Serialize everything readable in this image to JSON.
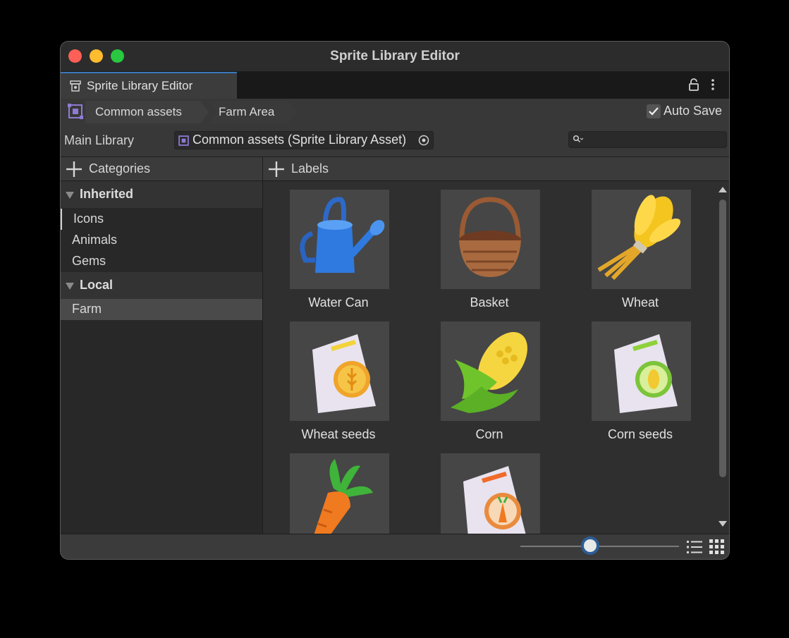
{
  "window": {
    "title": "Sprite Library Editor"
  },
  "tab": {
    "label": "Sprite Library Editor",
    "icon": "sprite-library-icon"
  },
  "breadcrumb": {
    "items": [
      "Common assets",
      "Farm Area"
    ]
  },
  "auto_save": {
    "label": "Auto Save",
    "checked": true
  },
  "main_library": {
    "label": "Main Library",
    "value": "Common assets (Sprite Library Asset)"
  },
  "search": {
    "placeholder": ""
  },
  "categories": {
    "header": "Categories",
    "groups": [
      {
        "name": "Inherited",
        "items": [
          "Icons",
          "Animals",
          "Gems"
        ]
      },
      {
        "name": "Local",
        "items": [
          "Farm"
        ]
      }
    ],
    "selected": "Farm"
  },
  "labels": {
    "header": "Labels",
    "items": [
      {
        "name": "Water Can",
        "icon": "watering-can-icon"
      },
      {
        "name": "Basket",
        "icon": "basket-icon"
      },
      {
        "name": "Wheat",
        "icon": "wheat-icon"
      },
      {
        "name": "Wheat seeds",
        "icon": "wheat-seeds-icon"
      },
      {
        "name": "Corn",
        "icon": "corn-icon"
      },
      {
        "name": "Corn seeds",
        "icon": "corn-seeds-icon"
      },
      {
        "name": "",
        "icon": "carrot-icon"
      },
      {
        "name": "",
        "icon": "carrot-seeds-icon"
      }
    ]
  },
  "zoom_slider": {
    "value": 0.45
  },
  "colors": {
    "accent": "#3a79bb",
    "slider_ring": "#2c5d96",
    "purple_icon": "#8f7bd6"
  }
}
